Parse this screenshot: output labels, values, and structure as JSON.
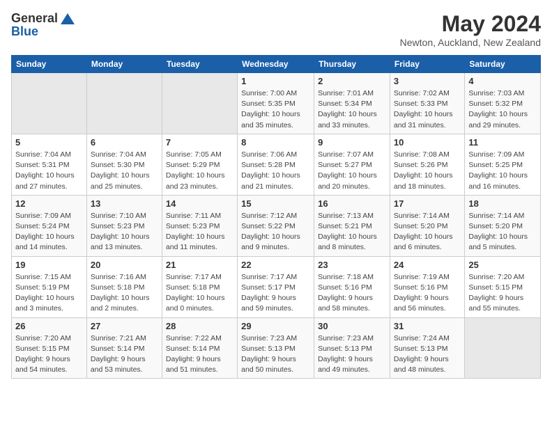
{
  "logo": {
    "general": "General",
    "blue": "Blue"
  },
  "title": "May 2024",
  "location": "Newton, Auckland, New Zealand",
  "days_header": [
    "Sunday",
    "Monday",
    "Tuesday",
    "Wednesday",
    "Thursday",
    "Friday",
    "Saturday"
  ],
  "weeks": [
    [
      {
        "day": "",
        "detail": ""
      },
      {
        "day": "",
        "detail": ""
      },
      {
        "day": "",
        "detail": ""
      },
      {
        "day": "1",
        "detail": "Sunrise: 7:00 AM\nSunset: 5:35 PM\nDaylight: 10 hours\nand 35 minutes."
      },
      {
        "day": "2",
        "detail": "Sunrise: 7:01 AM\nSunset: 5:34 PM\nDaylight: 10 hours\nand 33 minutes."
      },
      {
        "day": "3",
        "detail": "Sunrise: 7:02 AM\nSunset: 5:33 PM\nDaylight: 10 hours\nand 31 minutes."
      },
      {
        "day": "4",
        "detail": "Sunrise: 7:03 AM\nSunset: 5:32 PM\nDaylight: 10 hours\nand 29 minutes."
      }
    ],
    [
      {
        "day": "5",
        "detail": "Sunrise: 7:04 AM\nSunset: 5:31 PM\nDaylight: 10 hours\nand 27 minutes."
      },
      {
        "day": "6",
        "detail": "Sunrise: 7:04 AM\nSunset: 5:30 PM\nDaylight: 10 hours\nand 25 minutes."
      },
      {
        "day": "7",
        "detail": "Sunrise: 7:05 AM\nSunset: 5:29 PM\nDaylight: 10 hours\nand 23 minutes."
      },
      {
        "day": "8",
        "detail": "Sunrise: 7:06 AM\nSunset: 5:28 PM\nDaylight: 10 hours\nand 21 minutes."
      },
      {
        "day": "9",
        "detail": "Sunrise: 7:07 AM\nSunset: 5:27 PM\nDaylight: 10 hours\nand 20 minutes."
      },
      {
        "day": "10",
        "detail": "Sunrise: 7:08 AM\nSunset: 5:26 PM\nDaylight: 10 hours\nand 18 minutes."
      },
      {
        "day": "11",
        "detail": "Sunrise: 7:09 AM\nSunset: 5:25 PM\nDaylight: 10 hours\nand 16 minutes."
      }
    ],
    [
      {
        "day": "12",
        "detail": "Sunrise: 7:09 AM\nSunset: 5:24 PM\nDaylight: 10 hours\nand 14 minutes."
      },
      {
        "day": "13",
        "detail": "Sunrise: 7:10 AM\nSunset: 5:23 PM\nDaylight: 10 hours\nand 13 minutes."
      },
      {
        "day": "14",
        "detail": "Sunrise: 7:11 AM\nSunset: 5:23 PM\nDaylight: 10 hours\nand 11 minutes."
      },
      {
        "day": "15",
        "detail": "Sunrise: 7:12 AM\nSunset: 5:22 PM\nDaylight: 10 hours\nand 9 minutes."
      },
      {
        "day": "16",
        "detail": "Sunrise: 7:13 AM\nSunset: 5:21 PM\nDaylight: 10 hours\nand 8 minutes."
      },
      {
        "day": "17",
        "detail": "Sunrise: 7:14 AM\nSunset: 5:20 PM\nDaylight: 10 hours\nand 6 minutes."
      },
      {
        "day": "18",
        "detail": "Sunrise: 7:14 AM\nSunset: 5:20 PM\nDaylight: 10 hours\nand 5 minutes."
      }
    ],
    [
      {
        "day": "19",
        "detail": "Sunrise: 7:15 AM\nSunset: 5:19 PM\nDaylight: 10 hours\nand 3 minutes."
      },
      {
        "day": "20",
        "detail": "Sunrise: 7:16 AM\nSunset: 5:18 PM\nDaylight: 10 hours\nand 2 minutes."
      },
      {
        "day": "21",
        "detail": "Sunrise: 7:17 AM\nSunset: 5:18 PM\nDaylight: 10 hours\nand 0 minutes."
      },
      {
        "day": "22",
        "detail": "Sunrise: 7:17 AM\nSunset: 5:17 PM\nDaylight: 9 hours\nand 59 minutes."
      },
      {
        "day": "23",
        "detail": "Sunrise: 7:18 AM\nSunset: 5:16 PM\nDaylight: 9 hours\nand 58 minutes."
      },
      {
        "day": "24",
        "detail": "Sunrise: 7:19 AM\nSunset: 5:16 PM\nDaylight: 9 hours\nand 56 minutes."
      },
      {
        "day": "25",
        "detail": "Sunrise: 7:20 AM\nSunset: 5:15 PM\nDaylight: 9 hours\nand 55 minutes."
      }
    ],
    [
      {
        "day": "26",
        "detail": "Sunrise: 7:20 AM\nSunset: 5:15 PM\nDaylight: 9 hours\nand 54 minutes."
      },
      {
        "day": "27",
        "detail": "Sunrise: 7:21 AM\nSunset: 5:14 PM\nDaylight: 9 hours\nand 53 minutes."
      },
      {
        "day": "28",
        "detail": "Sunrise: 7:22 AM\nSunset: 5:14 PM\nDaylight: 9 hours\nand 51 minutes."
      },
      {
        "day": "29",
        "detail": "Sunrise: 7:23 AM\nSunset: 5:13 PM\nDaylight: 9 hours\nand 50 minutes."
      },
      {
        "day": "30",
        "detail": "Sunrise: 7:23 AM\nSunset: 5:13 PM\nDaylight: 9 hours\nand 49 minutes."
      },
      {
        "day": "31",
        "detail": "Sunrise: 7:24 AM\nSunset: 5:13 PM\nDaylight: 9 hours\nand 48 minutes."
      },
      {
        "day": "",
        "detail": ""
      }
    ]
  ]
}
